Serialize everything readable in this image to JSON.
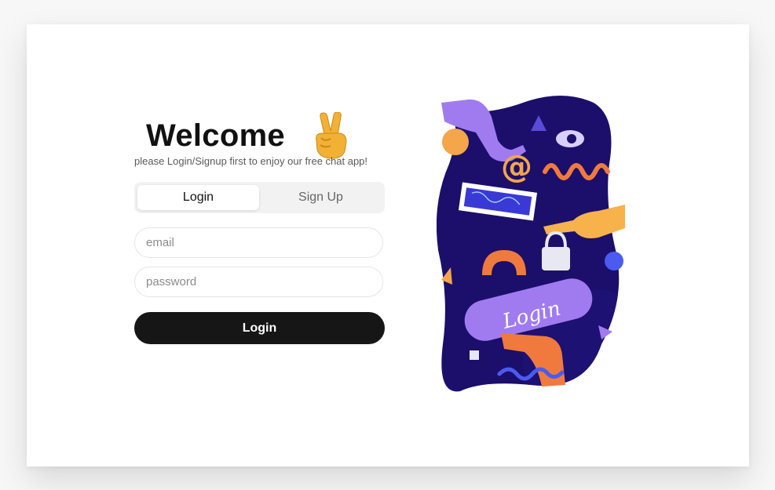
{
  "header": {
    "title": "Welcome",
    "subtitle": "please Login/Signup first to enjoy our free chat app!"
  },
  "tabs": [
    {
      "label": "Login",
      "active": true
    },
    {
      "label": "Sign Up",
      "active": false
    }
  ],
  "form": {
    "email": {
      "placeholder": "email",
      "value": ""
    },
    "password": {
      "placeholder": "password",
      "value": ""
    },
    "submit_label": "Login"
  },
  "illustration": {
    "sign_text": "Login",
    "icon": "login-illustration"
  },
  "colors": {
    "accent": "#161616",
    "illustration_bg": "#1b0f6b",
    "purple": "#9b6cf0",
    "orange": "#f07a3e",
    "yellow": "#f7b24b"
  }
}
